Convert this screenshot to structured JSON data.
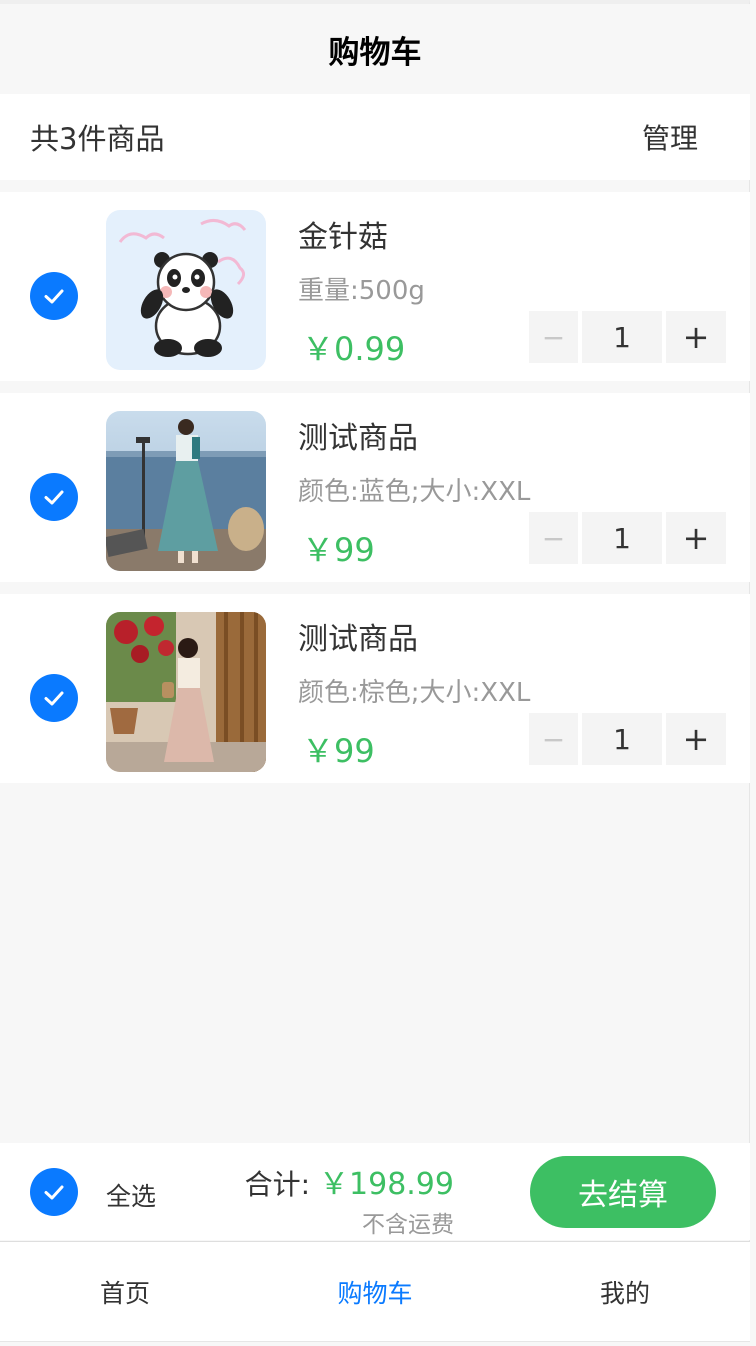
{
  "navbar": {
    "title": "购物车"
  },
  "summary": {
    "count_text": "共3件商品",
    "manage_label": "管理"
  },
  "items": [
    {
      "name": "金针菇",
      "spec": "重量:500g",
      "price": "￥0.99",
      "qty": "1",
      "checked": true,
      "image": "panda-illustration"
    },
    {
      "name": "测试商品",
      "spec": "颜色:蓝色;大小:XXL",
      "price": "￥99",
      "qty": "1",
      "checked": true,
      "image": "woman-blue-dress-seaside"
    },
    {
      "name": "测试商品",
      "spec": "颜色:棕色;大小:XXL",
      "price": "￥99",
      "qty": "1",
      "checked": true,
      "image": "woman-beige-dress-garden"
    }
  ],
  "stepper": {
    "minus": "−",
    "plus": "+"
  },
  "footer": {
    "select_all_label": "全选",
    "total_label": "合计:",
    "total_amount": "￥198.99",
    "shipping_note": "不含运费",
    "checkout_label": "去结算"
  },
  "tabbar": {
    "tabs": [
      {
        "label": "首页",
        "active": false
      },
      {
        "label": "购物车",
        "active": true
      },
      {
        "label": "我的",
        "active": false
      }
    ]
  },
  "colors": {
    "accent_blue": "#0a7aff",
    "price_green": "#3dbf63",
    "background": "#f7f7f7"
  },
  "icons": {
    "check": "check-icon"
  }
}
